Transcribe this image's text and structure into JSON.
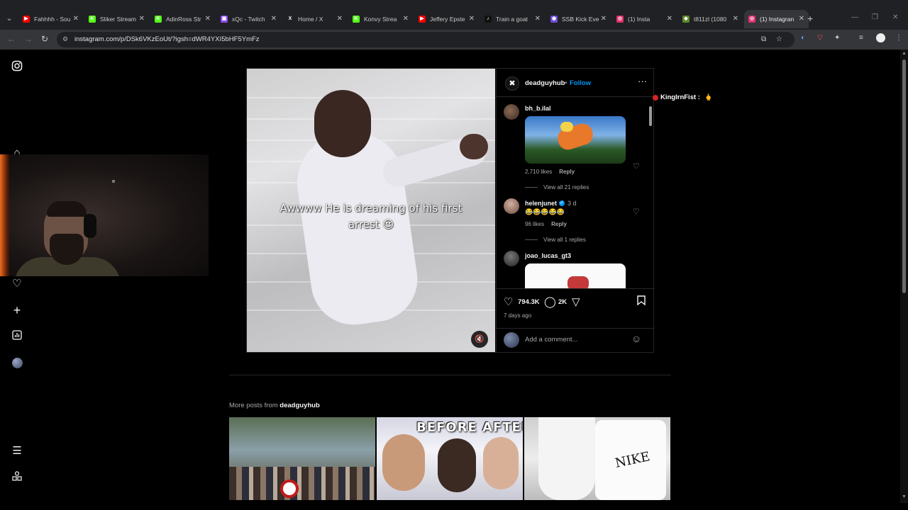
{
  "browser": {
    "tabs": [
      {
        "title": "Fahhhh - Sou",
        "color": "#ff0000",
        "glyph": "▶"
      },
      {
        "title": "Sliker Stream",
        "color": "#53fc18",
        "glyph": "K"
      },
      {
        "title": "AdinRoss Str",
        "color": "#53fc18",
        "glyph": "K"
      },
      {
        "title": "xQc - Twitch",
        "color": "#9146ff",
        "glyph": "▣"
      },
      {
        "title": "Home / X",
        "color": "#202124",
        "glyph": "X"
      },
      {
        "title": "Konvy Strea",
        "color": "#53fc18",
        "glyph": "K"
      },
      {
        "title": "Jeffery Epste",
        "color": "#ff0000",
        "glyph": "▶"
      },
      {
        "title": "Train a goat",
        "color": "#111111",
        "glyph": "♪"
      },
      {
        "title": "SSB Kick Eve",
        "color": "#6c4bd6",
        "glyph": "◉"
      },
      {
        "title": "(1) Insta",
        "color": "#e1306c",
        "glyph": "◎"
      },
      {
        "title": "t811zl (1080",
        "color": "#5a8a2a",
        "glyph": "◆"
      },
      {
        "title": "(1) Instagran",
        "color": "#e1306c",
        "glyph": "◎"
      }
    ],
    "url": "instagram.com/p/DSk6VKzEoUt/?igsh=dWR4YXI5bHF5YmFz"
  },
  "sidebar": {
    "icons": [
      "instagram-logo-icon",
      "home-icon",
      "notifications-heart-icon",
      "create-plus-icon",
      "dashboard-icon",
      "profile-avatar",
      "more-menu-icon",
      "also-from-meta-icon"
    ]
  },
  "post": {
    "username": "deadguyhub",
    "separator": "•",
    "follow_label": "Follow",
    "video_caption": "Awwww He is dreaming of his first arrest 😍",
    "likes": "794.3K",
    "comments_count": "2K",
    "timestamp": "7 days ago",
    "add_comment_placeholder": "Add a comment..."
  },
  "comments": [
    {
      "user": "bh_b.ilal",
      "likes": "2,710 likes",
      "reply": "Reply",
      "view_replies": "View all 21 replies"
    },
    {
      "user": "helenjunet",
      "verified": true,
      "age": "3 d",
      "text": "😂😂😂😂😂",
      "likes": "96 likes",
      "reply": "Reply",
      "view_replies": "View all 1 replies"
    },
    {
      "user": "joao_lucas_gt3"
    }
  ],
  "chat_overlay": {
    "user": "KingIrnFist :"
  },
  "more_posts": {
    "prefix": "More posts from",
    "username": "deadguyhub",
    "thumb2_text": "BEFORE AFTER",
    "thumb3_text": "NIKE"
  }
}
